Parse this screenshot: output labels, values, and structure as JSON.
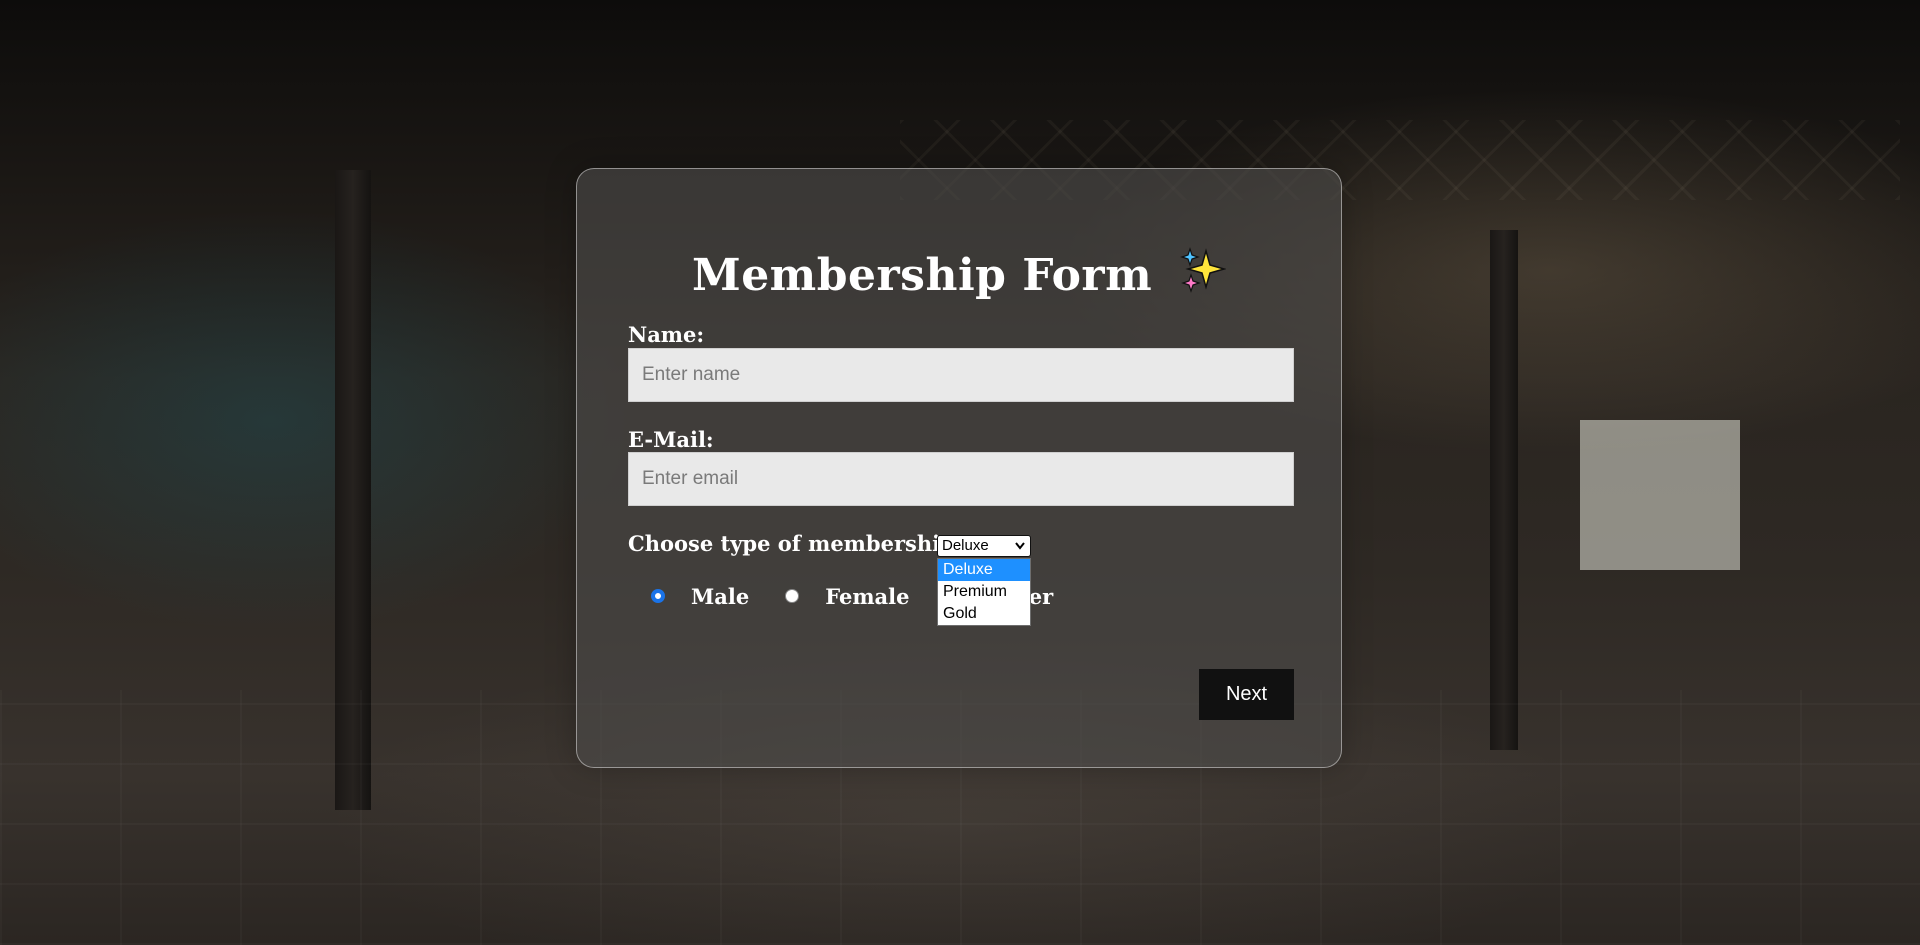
{
  "form": {
    "title": "Membership Form",
    "title_icon": "sparkles-icon",
    "name_label": "Name:",
    "name_placeholder": "Enter name",
    "email_label": "E-Mail:",
    "email_placeholder": "Enter email",
    "membership_label": "Choose type of membership:",
    "membership_selected": "Deluxe",
    "membership_options": [
      "Deluxe",
      "Premium",
      "Gold"
    ],
    "gender_options": [
      "Male",
      "Female",
      "Other"
    ],
    "gender_selected": "Male",
    "next_label": "Next"
  },
  "colors": {
    "accent": "#1e90ff",
    "button_bg": "#111111",
    "input_bg": "#e9e9e9"
  }
}
